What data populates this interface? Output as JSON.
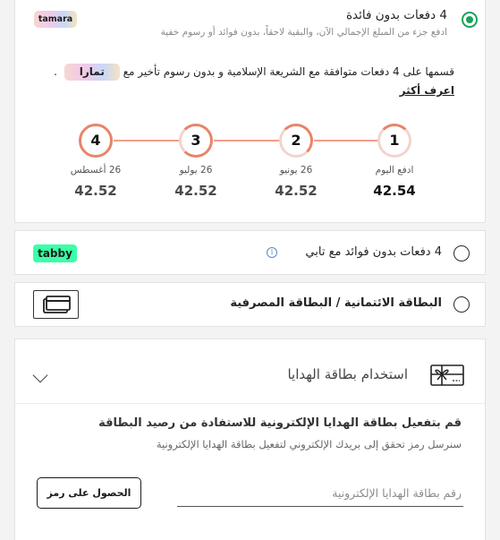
{
  "tamara": {
    "logo_text": "tamara",
    "title": "4 دفعات بدون فائدة",
    "subtitle": "ادفع جزء من المبلغ الإجمالي الآن، والبقية لاحقاً، بدون فوائد أو رسوم خفية",
    "description": "قسمها على 4 دفعات متوافقة مع الشريعة الإسلامية و بدون رسوم تأخير مع",
    "inline_logo_text": "تمارا",
    "learn_more": "اعرف أكثر",
    "selected": true,
    "steps": [
      {
        "number": "1",
        "date": "ادفع اليوم",
        "amount": "42.54"
      },
      {
        "number": "2",
        "date": "26 يونيو",
        "amount": "42.52"
      },
      {
        "number": "3",
        "date": "26 يوليو",
        "amount": "42.52"
      },
      {
        "number": "4",
        "date": "26 أغسطس",
        "amount": "42.52"
      }
    ],
    "colors": {
      "accent": "#e88468",
      "radio_selected": "#19a35c"
    }
  },
  "tabby": {
    "logo_text": "tabby",
    "label": "4 دفعات بدون فوائد مع تابي",
    "info_icon": "i",
    "colors": {
      "logo_bg": "#3bffa8"
    }
  },
  "card": {
    "label": "البطاقة الائتمانية / البطاقة المصرفية",
    "icon": "credit-card-icon"
  },
  "gift": {
    "title": "استخدام بطاقة الهدايا",
    "heading": "قم بتفعيل بطاقة الهدايا الإلكترونية للاستفادة من رصيد البطاقة",
    "subtext": "سنرسل رمز تحقق إلى بريدك الإلكتروني لتفعيل بطاقة الهدايا الإلكترونية",
    "input_placeholder": "رقم بطاقة الهدايا الإلكترونية",
    "input_value": "",
    "otp_button": "الحصول على رمز",
    "icon": "gift-card-icon"
  }
}
